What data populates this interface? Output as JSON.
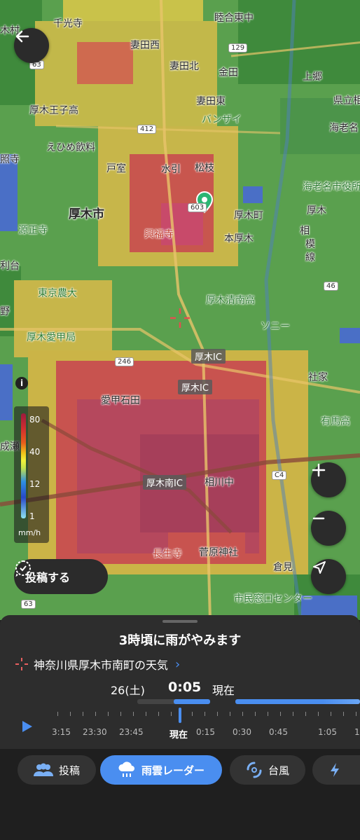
{
  "legend": {
    "values": [
      "80",
      "40",
      "12",
      "1"
    ],
    "unit": "mm/h"
  },
  "map_labels": {
    "l1": "千光寺",
    "l2": "睦合東中",
    "l3": "妻田西",
    "l4": "妻田北",
    "l5": "金田",
    "l6": "上郷",
    "l7": "県立相",
    "l8": "厚木王子高",
    "l9": "妻田東",
    "l10": "バンザイ",
    "l11": "海老名",
    "l12": "えひめ飲料",
    "l13": "戸室",
    "l14": "水引",
    "l15": "松枝",
    "l16": "海老名市役所",
    "l17": "厚木市",
    "l18": "厚木町",
    "l19": "厚木",
    "l20": "源正寺",
    "l21": "興福寺",
    "l22": "本厚木",
    "l23": "相",
    "l24": "模",
    "l25": "線",
    "l26": "利台",
    "l27": "東京農大",
    "l28": "厚木清南高",
    "l29": "野",
    "l30": "厚木愛甲局",
    "l31": "ソニー",
    "l32": "社家",
    "l33": "愛甲石田",
    "l34": "有馬高",
    "l35": "相川中",
    "l36": "長生寺",
    "l37": "菅原神社",
    "l38": "倉見",
    "l39": "市民窓口センター",
    "l40": "成瀬",
    "l41": "照寺",
    "l42": "木村"
  },
  "road_signs": {
    "ic1": "厚木IC",
    "ic2": "厚木IC",
    "ic3": "厚木南IC"
  },
  "route_badges": [
    "63",
    "129",
    "412",
    "603",
    "46",
    "246",
    "C4",
    "63"
  ],
  "buttons": {
    "post": "投稿する"
  },
  "bottom_sheet": {
    "headline": "3時頃に雨がやみます",
    "location": "神奈川県厚木市南町の天気",
    "date": "26(土)",
    "time": "0:05",
    "now": "現在",
    "timeline_labels": [
      "3:15",
      "23:30",
      "23:45",
      "現在",
      "0:15",
      "0:30",
      "0:45",
      "1:05",
      "1"
    ]
  },
  "tabs": [
    {
      "label": "投稿",
      "active": false
    },
    {
      "label": "雨雲レーダー",
      "active": true
    },
    {
      "label": "台風",
      "active": false
    }
  ],
  "colors": {
    "accent": "#4a8ef0",
    "sheet": "#2d2d2d"
  }
}
